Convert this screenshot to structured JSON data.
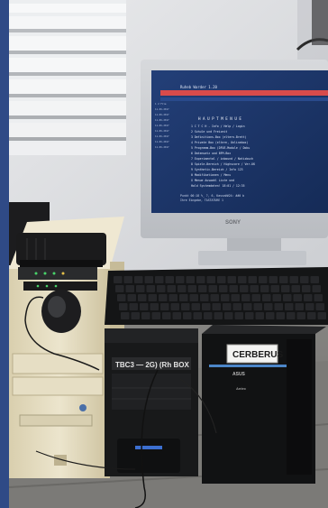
{
  "photo": {
    "monitor_brand": "SONY",
    "terminal_title": "Ruheb Warder 1.20",
    "terminal_menu_heading": "H A U P T M E N U E",
    "terminal_menu_lines": [
      "1 C T C H  -  Info / Help / Login",
      "2 Schule und Freizeit",
      "3 Definitions-Box (eltern-Brett)",
      "4 Private Box (eltern, Onlinebox)",
      "5 Programm-Box (DFUE-Module / Doku",
      "6 Datensatz und BFM-Box",
      "7 Experimental / inbound / Notizbuch",
      "8 Spiele-Bereich / Highscore / Ver-UK",
      "9 Synthetic-Bereich / Info 123",
      "0 Modifikationen / Menu",
      "X Menue Auswahl Liste und",
      "   Hold Systemdaten!  18:01 / 12:35"
    ],
    "terminal_prompt_line1": "Punkt 00:18 %_ ?, 6, Kasse##24: ##0 b",
    "terminal_prompt_line2": "Ihre Eingabe, TASTATURE 1",
    "tower_left_label": "TBC3  — 2G) (Rh  BOX",
    "tower_right_label": "CERBERUS",
    "tower_right_brand": "ASUS",
    "tower_right_small": "Antec"
  },
  "colors": {
    "border_blue": "#2f4a86",
    "wall": "#d9dadd",
    "beige_case": "#e4dcc1",
    "black_case": "#161718",
    "screen_bg": "#1b3466"
  }
}
